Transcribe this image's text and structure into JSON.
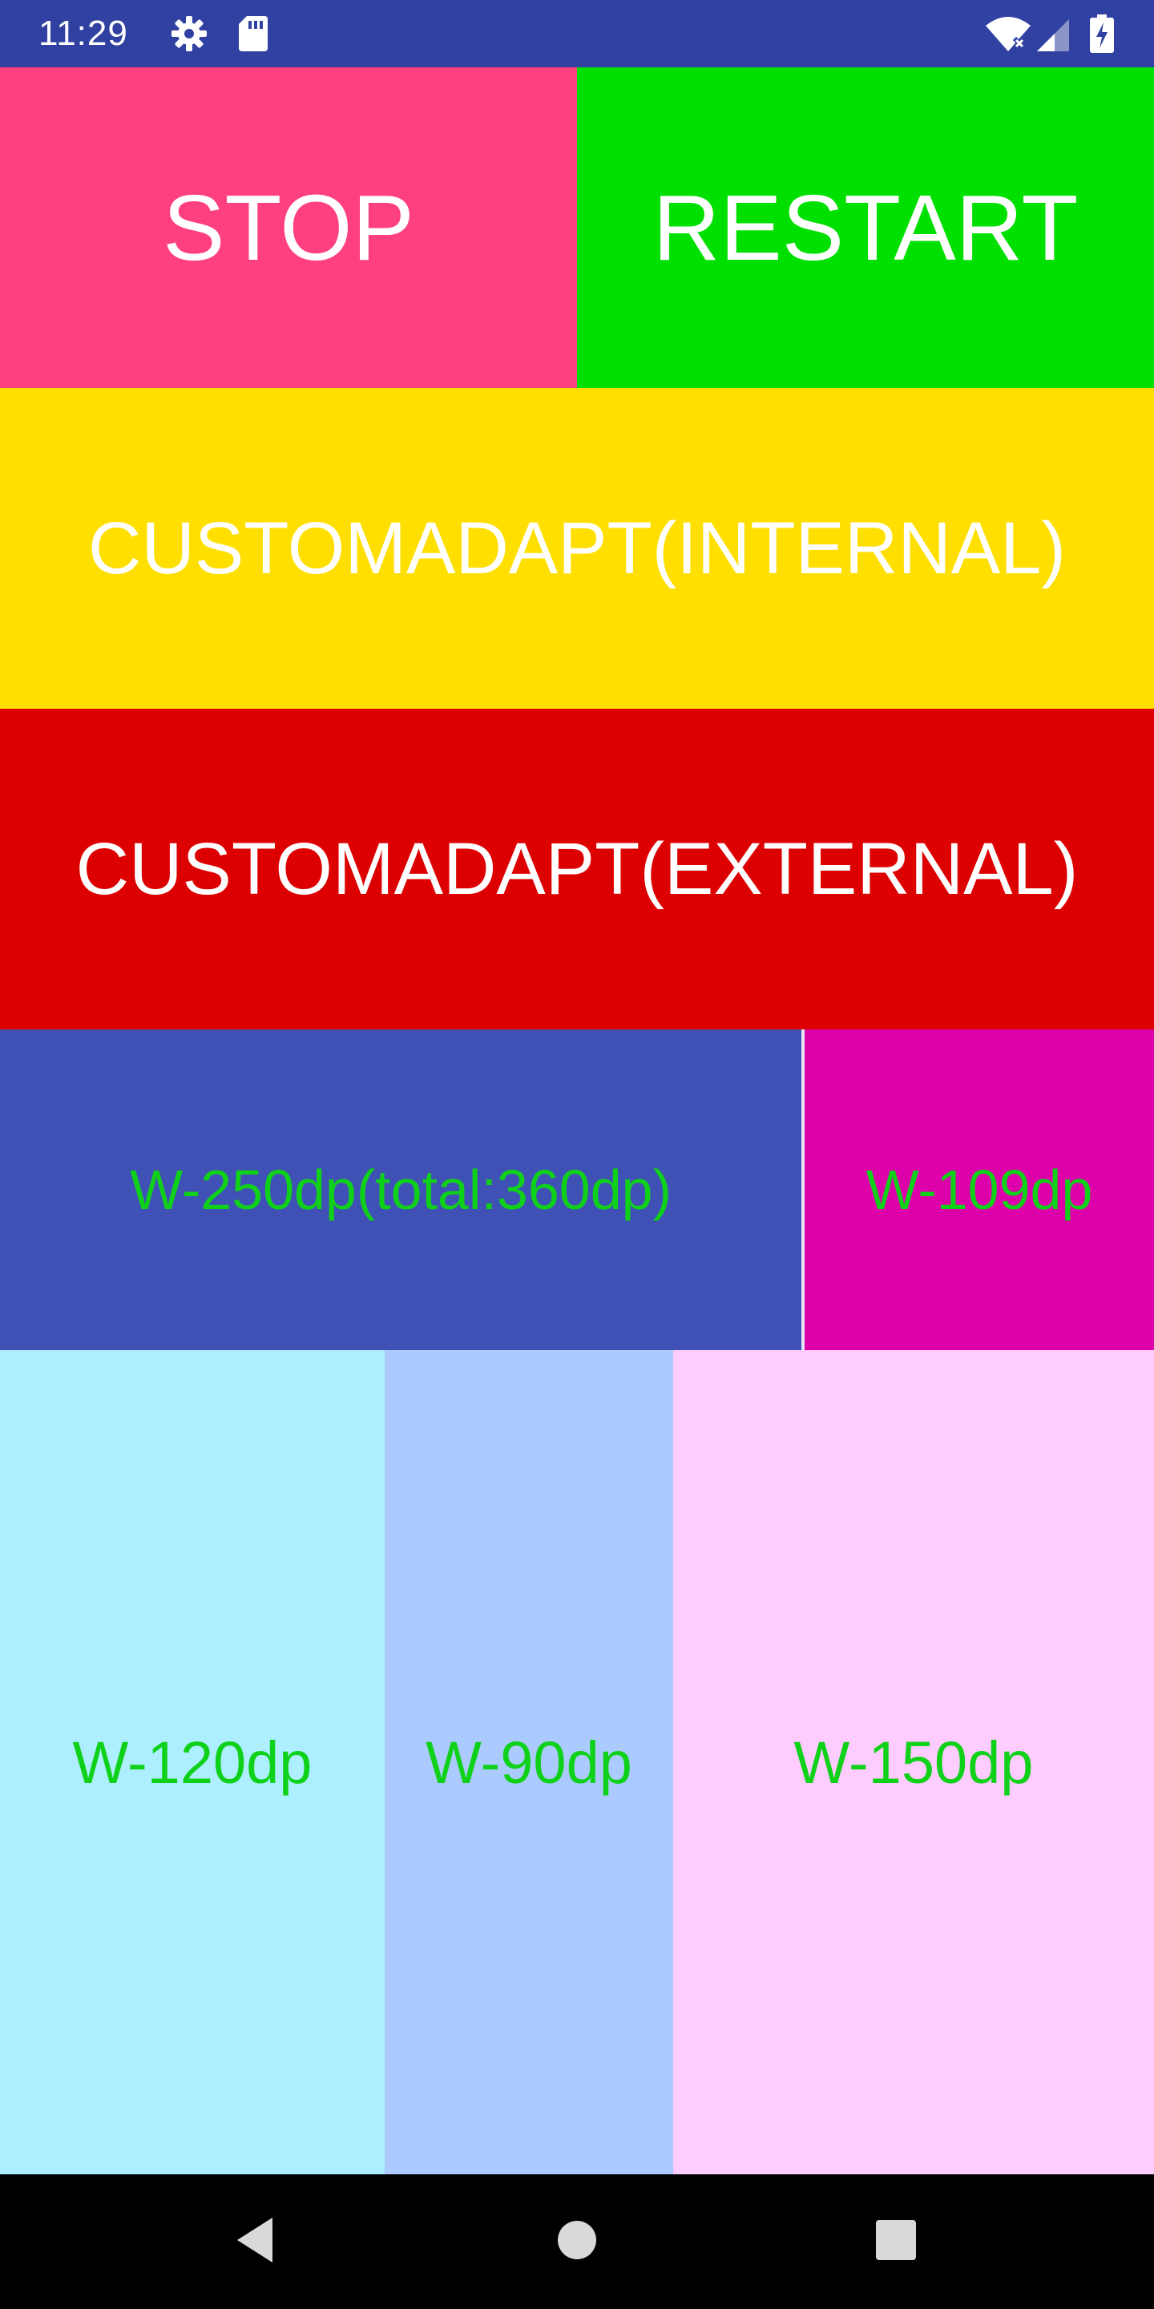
{
  "status_bar": {
    "time": "11:29",
    "icons": [
      "gear-icon",
      "sd-card-icon",
      "wifi-icon",
      "signal-icon",
      "battery-charging-icon"
    ]
  },
  "buttons": {
    "stop": "STOP",
    "restart": "RESTART",
    "customadapt_internal": "CUSTOMADAPT(INTERNAL)",
    "customadapt_external": "CUSTOMADAPT(EXTERNAL)"
  },
  "blocks": {
    "w250": "W-250dp(total:360dp)",
    "w109": "W-109dp",
    "w120": "W-120dp",
    "w90": "W-90dp",
    "w150": "W-150dp"
  },
  "nav_bar": {
    "icons": [
      "back-icon",
      "home-icon",
      "recents-icon"
    ]
  },
  "colors": {
    "status_bar": "#3141a1",
    "stop": "#ff4080",
    "restart": "#00e000",
    "customadapt_internal": "#ffdf00",
    "customadapt_external": "#dd0000",
    "w250": "#3f51b5",
    "w109": "#dd00aa",
    "w120": "#adeeff",
    "w90": "#abcbff",
    "w150": "#ffccff",
    "label_green": "#10d11a"
  }
}
